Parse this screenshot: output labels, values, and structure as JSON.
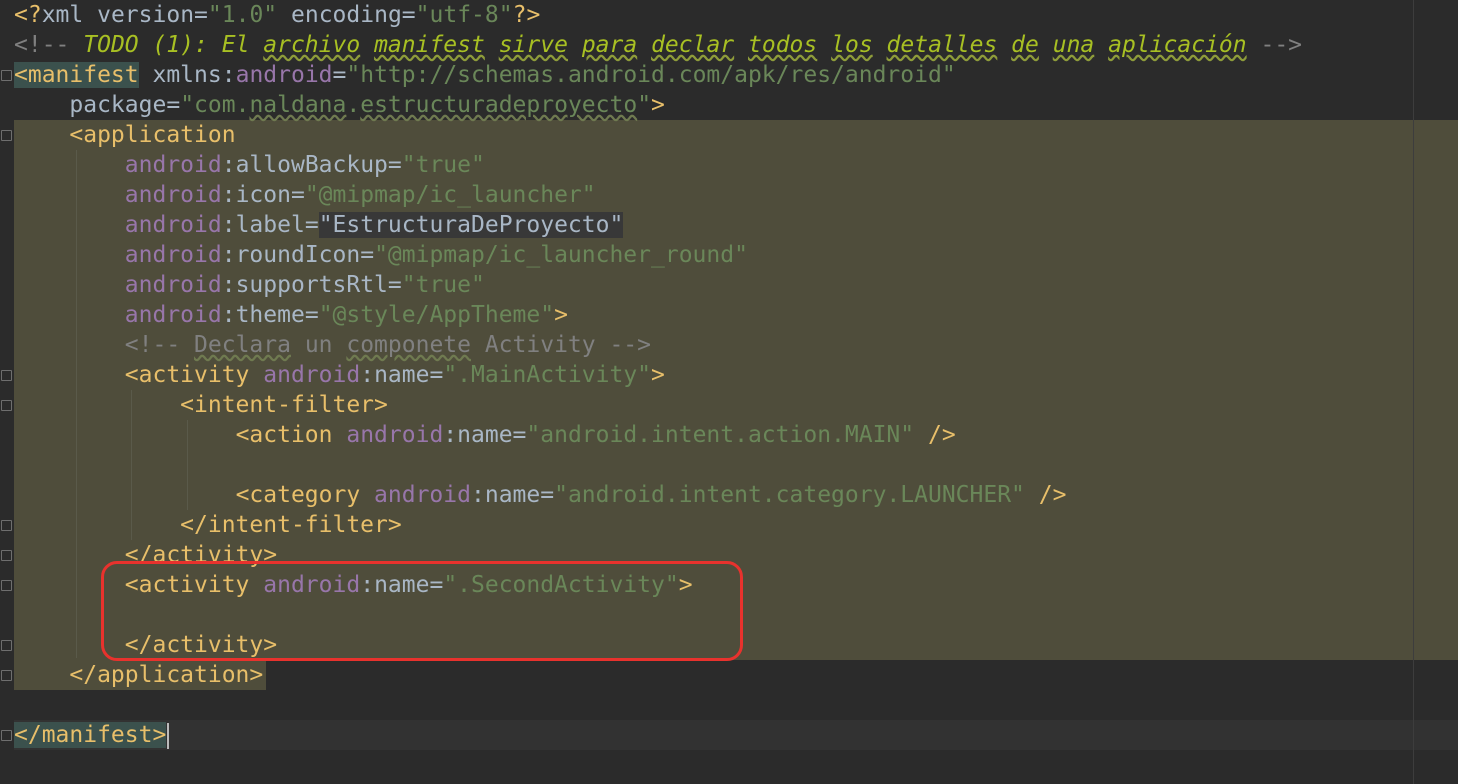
{
  "editor": {
    "lines": {
      "l1": {
        "open": "<?",
        "tag": "xml",
        "a1": "version",
        "v1": "\"1.0\"",
        "a2": "encoding",
        "v2": "\"utf-8\"",
        "close": "?>"
      },
      "l2": {
        "open": "<!-- ",
        "w1": "TODO (1): El ",
        "u1": "archivo",
        "w2": " ",
        "u2": "manifest",
        "w3": " ",
        "u3": "sirve",
        "w4": " ",
        "u4": "para",
        "w5": " ",
        "u5": "declar",
        "w6": " ",
        "u6": "todos",
        "w7": " ",
        "u7": "los",
        "w8": " ",
        "u8": "detalles",
        "w9": " ",
        "u9": "de",
        "w10": " ",
        "u10": "una",
        "w11": " ",
        "u11": "aplicación",
        "close": " -->"
      },
      "l3": {
        "open": "<manifest",
        "attr": "xmlns",
        "ns": "android",
        "val": "\"http://schemas.android.com/apk/res/android\""
      },
      "l4": {
        "attr": "package",
        "val": "\"com.",
        "val_u1": "naldana",
        "val2": ".",
        "val_u2": "estructuradeproyecto",
        "val3": "\"",
        "close": ">"
      },
      "l5": {
        "open": "<application"
      },
      "l6": {
        "ns": "android",
        "attr": "allowBackup",
        "val": "\"true\""
      },
      "l7": {
        "ns": "android",
        "attr": "icon",
        "val": "\"@mipmap/ic_launcher\""
      },
      "l8": {
        "ns": "android",
        "attr": "label",
        "val": "\"EstructuraDeProyecto\""
      },
      "l9": {
        "ns": "android",
        "attr": "roundIcon",
        "val": "\"@mipmap/ic_launcher_round\""
      },
      "l10": {
        "ns": "android",
        "attr": "supportsRtl",
        "val": "\"true\""
      },
      "l11": {
        "ns": "android",
        "attr": "theme",
        "val": "\"@style/AppTheme\"",
        "close": ">"
      },
      "l12": {
        "open": "<!-- ",
        "u1": "Declara",
        "w1": " un ",
        "u2": "componete",
        "w2": " Activity",
        "close": " -->"
      },
      "l13": {
        "open": "<activity",
        "ns": "android",
        "attr": "name",
        "val": "\".MainActivity\"",
        "close": ">"
      },
      "l14": {
        "open": "<intent-filter",
        "close": ">"
      },
      "l15": {
        "open": "<action",
        "ns": "android",
        "attr": "name",
        "val": "\"android.intent.action.MAIN\"",
        "close": " />"
      },
      "l17": {
        "open": "<category",
        "ns": "android",
        "attr": "name",
        "val": "\"android.intent.category.LAUNCHER\"",
        "close": " />"
      },
      "l18": {
        "text": "</intent-filter>"
      },
      "l19": {
        "text": "</activity>"
      },
      "l20": {
        "open": "<activity",
        "ns": "android",
        "attr": "name",
        "val": "\".SecondActivity\"",
        "close": ">"
      },
      "l22": {
        "text": "</activity>"
      },
      "l23": {
        "text": "</application>"
      },
      "l25": {
        "text": "</manifest>"
      }
    }
  },
  "colors": {
    "background": "#2b2b2b",
    "tag": "#e8bf6a",
    "attribute": "#a9b7c6",
    "namespace": "#9876aa",
    "string": "#6a8759",
    "comment": "#808080",
    "todo": "#a8c023",
    "scope_highlight": "#4f4d3b",
    "annotation_box": "#e8322d"
  }
}
